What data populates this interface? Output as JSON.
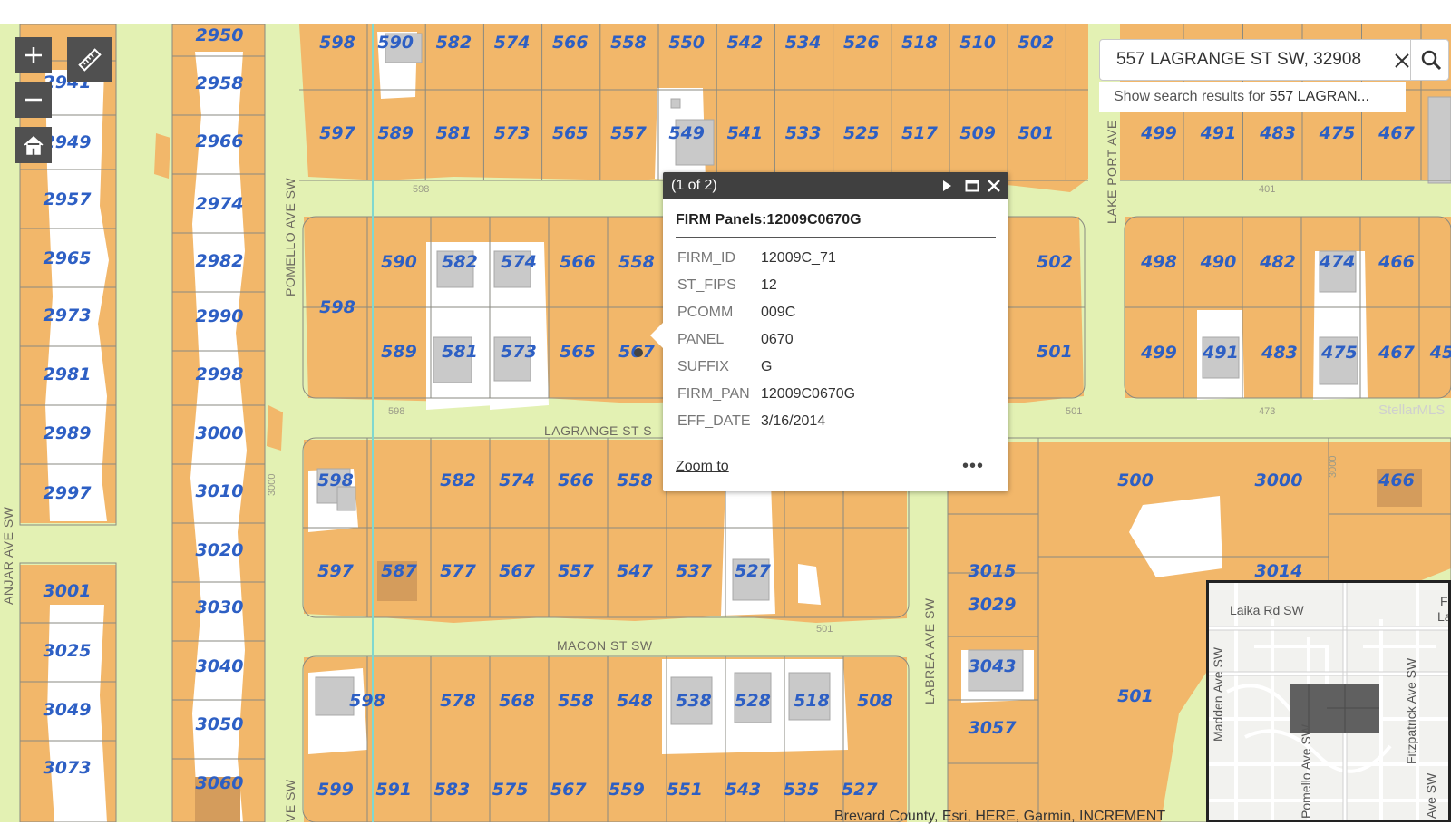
{
  "map": {
    "streets": {
      "pomello": "POMELLO AVE SW",
      "lagrange": "LAGRANGE ST S",
      "macon": "MACON ST SW",
      "lake_port": "LAKE PORT AVE",
      "labrea": "LABREA AVE SW",
      "anjar": "ANJAR AVE SW",
      "ave_sw_bottom": "VE SW"
    },
    "parcels": {
      "col_a": [
        "2941",
        "2949",
        "2957",
        "2965",
        "2973",
        "2981",
        "2989",
        "2997",
        "3001",
        "3025",
        "3049",
        "3073"
      ],
      "col_b": [
        "2950",
        "2958",
        "2966",
        "2974",
        "2982",
        "2990",
        "2998",
        "3000",
        "3010",
        "3020",
        "3030",
        "3040",
        "3050",
        "3060"
      ],
      "row1": [
        "598",
        "590",
        "582",
        "574",
        "566",
        "558",
        "550",
        "542",
        "534",
        "526",
        "518",
        "510",
        "502"
      ],
      "row2": [
        "597",
        "589",
        "581",
        "573",
        "565",
        "557",
        "549",
        "541",
        "533",
        "525",
        "517",
        "509",
        "501"
      ],
      "right_row1": [
        "499",
        "491",
        "483",
        "475",
        "467"
      ],
      "row3": [
        "598",
        "590",
        "582",
        "574",
        "566",
        "558",
        "502"
      ],
      "right_row2": [
        "498",
        "490",
        "482",
        "474",
        "466"
      ],
      "row4": [
        "589",
        "581",
        "573",
        "565",
        "567",
        "501"
      ],
      "right_row3": [
        "499",
        "491",
        "483",
        "475",
        "467",
        "45"
      ],
      "row5": [
        "598",
        "582",
        "574",
        "566",
        "558",
        "500",
        "3000",
        "466"
      ],
      "row6": [
        "597",
        "587",
        "577",
        "567",
        "557",
        "547",
        "537",
        "527",
        "3015",
        "3014"
      ],
      "row7": [
        "3029",
        "3043",
        "501",
        "3057"
      ],
      "row8": [
        "598",
        "578",
        "568",
        "558",
        "548",
        "538",
        "528",
        "518",
        "508"
      ],
      "row9": [
        "599",
        "591",
        "583",
        "575",
        "567",
        "559",
        "551",
        "543",
        "535",
        "527"
      ],
      "small": [
        "598",
        "598",
        "401",
        "473",
        "501",
        "501",
        "3000",
        "3000"
      ]
    },
    "watermark": "StellarMLS"
  },
  "controls": {
    "zoom_in_icon": "plus-icon",
    "zoom_out_icon": "minus-icon",
    "home_icon": "home-icon",
    "measure_icon": "ruler-icon"
  },
  "search": {
    "value": "557 LAGRANGE ST SW, 32908",
    "suggestion_prefix": "Show search results for ",
    "suggestion_term": "557 LAGRAN..."
  },
  "popup": {
    "counter": "(1 of 2)",
    "title": "FIRM Panels:12009C0670G",
    "fields": [
      {
        "key": "FIRM_ID",
        "value": "12009C_71"
      },
      {
        "key": "ST_FIPS",
        "value": "12"
      },
      {
        "key": "PCOMM",
        "value": "009C"
      },
      {
        "key": "PANEL",
        "value": "0670"
      },
      {
        "key": "SUFFIX",
        "value": "G"
      },
      {
        "key": "FIRM_PAN",
        "value": "12009C0670G"
      },
      {
        "key": "EFF_DATE",
        "value": "3/16/2014"
      }
    ],
    "zoom_label": "Zoom to",
    "more_label": "•••"
  },
  "attribution": "Brevard County, Esri, HERE, Garmin, INCREMENT",
  "overview": {
    "road1": "Laika Rd SW",
    "road2": "Madden Ave SW",
    "road3": "Pomello Ave SW",
    "road4": "Fitzpatrick Ave SW",
    "road5": "Ave SW",
    "road6": "F",
    "road7": "La"
  },
  "colors": {
    "base": "#e3f1b3",
    "flood": "#f2b76a",
    "building": "#c8c8c8",
    "parcel_text": "#2d5fc4",
    "popup_header": "#404040",
    "waterline": "#7fd8d0"
  }
}
